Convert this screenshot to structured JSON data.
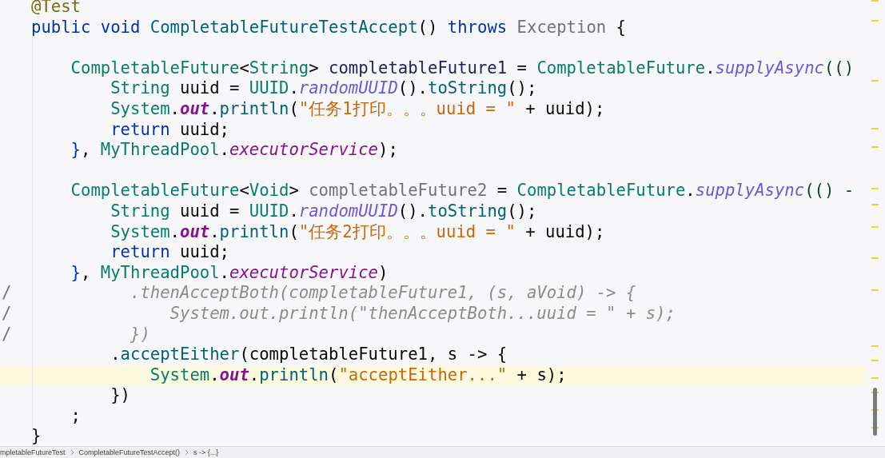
{
  "editor": {
    "blocks": [
      [
        {
          "tokens": [
            {
              "text": "@Test",
              "kind": "annotation"
            }
          ]
        },
        {
          "tokens": [
            {
              "text": "public",
              "kind": "keyword"
            },
            {
              "text": " void",
              "kind": "keyword"
            },
            {
              "text": " CompletableFutureTestAccept",
              "kind": "method"
            },
            {
              "text": "()",
              "kind": "plain"
            },
            {
              "text": " throws",
              "kind": "keyword"
            },
            {
              "text": " Exception",
              "kind": "unused"
            },
            {
              "text": " {",
              "kind": "plain"
            }
          ]
        }
      ],
      [
        {
          "tokens": [
            {
              "text": "    CompletableFuture",
              "kind": "class"
            },
            {
              "text": "<",
              "kind": "plain"
            },
            {
              "text": "String",
              "kind": "class"
            },
            {
              "text": ">",
              "kind": "plain"
            },
            {
              "text": " completableFuture1",
              "kind": "variable"
            },
            {
              "text": " = ",
              "kind": "plain"
            },
            {
              "text": "CompletableFuture",
              "kind": "class"
            },
            {
              "text": ".",
              "kind": "plain"
            },
            {
              "text": "supplyAsync",
              "kind": "static"
            },
            {
              "text": "(()",
              "kind": "paren"
            }
          ]
        },
        {
          "tokens": [
            {
              "text": "        String",
              "kind": "class"
            },
            {
              "text": " uuid = ",
              "kind": "plain"
            },
            {
              "text": "UUID",
              "kind": "class"
            },
            {
              "text": ".",
              "kind": "plain"
            },
            {
              "text": "randomUUID",
              "kind": "static"
            },
            {
              "text": "().",
              "kind": "plain"
            },
            {
              "text": "toString",
              "kind": "method"
            },
            {
              "text": "();",
              "kind": "plain"
            }
          ]
        },
        {
          "tokens": [
            {
              "text": "        System",
              "kind": "class"
            },
            {
              "text": ".",
              "kind": "plain"
            },
            {
              "text": "out",
              "kind": "field"
            },
            {
              "text": ".",
              "kind": "plain"
            },
            {
              "text": "println",
              "kind": "method"
            },
            {
              "text": "(",
              "kind": "plain"
            },
            {
              "text": "\"任务1打印。。。uuid = \"",
              "kind": "string"
            },
            {
              "text": " + uuid);",
              "kind": "plain"
            }
          ]
        },
        {
          "tokens": [
            {
              "text": "        return",
              "kind": "keyword"
            },
            {
              "text": " uuid;",
              "kind": "plain"
            }
          ]
        },
        {
          "tokens": [
            {
              "text": "    }",
              "kind": "brace"
            },
            {
              "text": ", ",
              "kind": "plain"
            },
            {
              "text": "MyThreadPool",
              "kind": "class"
            },
            {
              "text": ".",
              "kind": "plain"
            },
            {
              "text": "executorService",
              "kind": "static-field"
            },
            {
              "text": ");",
              "kind": "plain"
            }
          ]
        }
      ],
      [
        {
          "tokens": [
            {
              "text": "    CompletableFuture",
              "kind": "class"
            },
            {
              "text": "<",
              "kind": "plain"
            },
            {
              "text": "Void",
              "kind": "class"
            },
            {
              "text": ">",
              "kind": "plain"
            },
            {
              "text": " completableFuture2",
              "kind": "unused"
            },
            {
              "text": " = ",
              "kind": "plain"
            },
            {
              "text": "CompletableFuture",
              "kind": "class"
            },
            {
              "text": ".",
              "kind": "plain"
            },
            {
              "text": "supplyAsync",
              "kind": "static"
            },
            {
              "text": "(() -",
              "kind": "paren"
            }
          ]
        },
        {
          "tokens": [
            {
              "text": "        String",
              "kind": "class"
            },
            {
              "text": " uuid = ",
              "kind": "plain"
            },
            {
              "text": "UUID",
              "kind": "class"
            },
            {
              "text": ".",
              "kind": "plain"
            },
            {
              "text": "randomUUID",
              "kind": "static"
            },
            {
              "text": "().",
              "kind": "plain"
            },
            {
              "text": "toString",
              "kind": "method"
            },
            {
              "text": "();",
              "kind": "plain"
            }
          ]
        },
        {
          "tokens": [
            {
              "text": "        System",
              "kind": "class"
            },
            {
              "text": ".",
              "kind": "plain"
            },
            {
              "text": "out",
              "kind": "field"
            },
            {
              "text": ".",
              "kind": "plain"
            },
            {
              "text": "println",
              "kind": "method"
            },
            {
              "text": "(",
              "kind": "plain"
            },
            {
              "text": "\"任务2打印。。。uuid = \"",
              "kind": "string"
            },
            {
              "text": " + uuid);",
              "kind": "plain"
            }
          ]
        },
        {
          "tokens": [
            {
              "text": "        return",
              "kind": "keyword"
            },
            {
              "text": " uuid;",
              "kind": "plain"
            }
          ]
        },
        {
          "tokens": [
            {
              "text": "    }",
              "kind": "brace"
            },
            {
              "text": ", ",
              "kind": "plain"
            },
            {
              "text": "MyThreadPool",
              "kind": "class"
            },
            {
              "text": ".",
              "kind": "plain"
            },
            {
              "text": "executorService",
              "kind": "static-field"
            },
            {
              "text": ")",
              "kind": "plain"
            }
          ]
        },
        {
          "gutter": "/",
          "tokens": [
            {
              "text": "          .thenAcceptBoth(completableFuture1, (s, aVoid) -> {",
              "kind": "comment"
            }
          ]
        },
        {
          "gutter": "/",
          "tokens": [
            {
              "text": "              System.out.println(\"thenAcceptBoth...uuid = \" + s);",
              "kind": "comment"
            }
          ]
        },
        {
          "gutter": "/",
          "tokens": [
            {
              "text": "          })",
              "kind": "comment"
            }
          ]
        },
        {
          "tokens": [
            {
              "text": "        .",
              "kind": "plain"
            },
            {
              "text": "acceptEither",
              "kind": "method"
            },
            {
              "text": "(completableFuture1, s -> {",
              "kind": "plain"
            }
          ]
        },
        {
          "highlighted": true,
          "tokens": [
            {
              "text": "            System",
              "kind": "class"
            },
            {
              "text": ".",
              "kind": "plain"
            },
            {
              "text": "out",
              "kind": "field"
            },
            {
              "text": ".",
              "kind": "plain"
            },
            {
              "text": "println",
              "kind": "method"
            },
            {
              "text": "(",
              "kind": "plain"
            },
            {
              "text": "\"acceptEither...\"",
              "kind": "string"
            },
            {
              "text": " + s);",
              "kind": "plain"
            }
          ]
        },
        {
          "tokens": [
            {
              "text": "        })",
              "kind": "plain"
            }
          ]
        },
        {
          "tokens": [
            {
              "text": "    ;",
              "kind": "plain"
            }
          ]
        },
        {
          "tokens": [
            {
              "text": "}",
              "kind": "plain"
            }
          ]
        }
      ]
    ]
  },
  "breadcrumbs": [
    "mpletableFutureTest",
    "CompletableFutureTestAccept()",
    "s -> {...}"
  ]
}
